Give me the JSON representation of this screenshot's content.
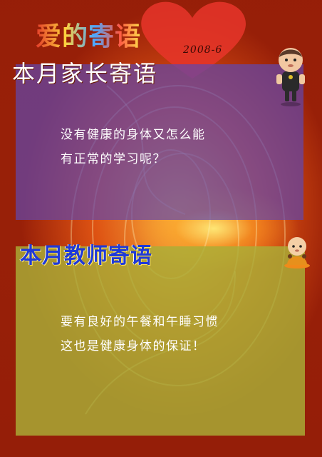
{
  "header": {
    "title": "爱的寄语",
    "date": "2008-6"
  },
  "parent_section": {
    "title": "本月家长寄语",
    "lines": [
      "没有健康的身体又怎么能",
      "有正常的学习呢？"
    ]
  },
  "teacher_section": {
    "title": "本月教师寄语",
    "lines": [
      "要有良好的午餐和午睡习惯",
      "这也是健康身体的保证！"
    ]
  },
  "colors": {
    "background_red": "#a32a0c",
    "heart_red": "#e8352a",
    "parent_panel": "#6246aa",
    "teacher_panel": "#aaaf37",
    "teacher_title_blue": "#1f3ad8"
  },
  "icons": [
    "heart-icon",
    "cartoon-boy-icon",
    "cartoon-monk-icon"
  ]
}
